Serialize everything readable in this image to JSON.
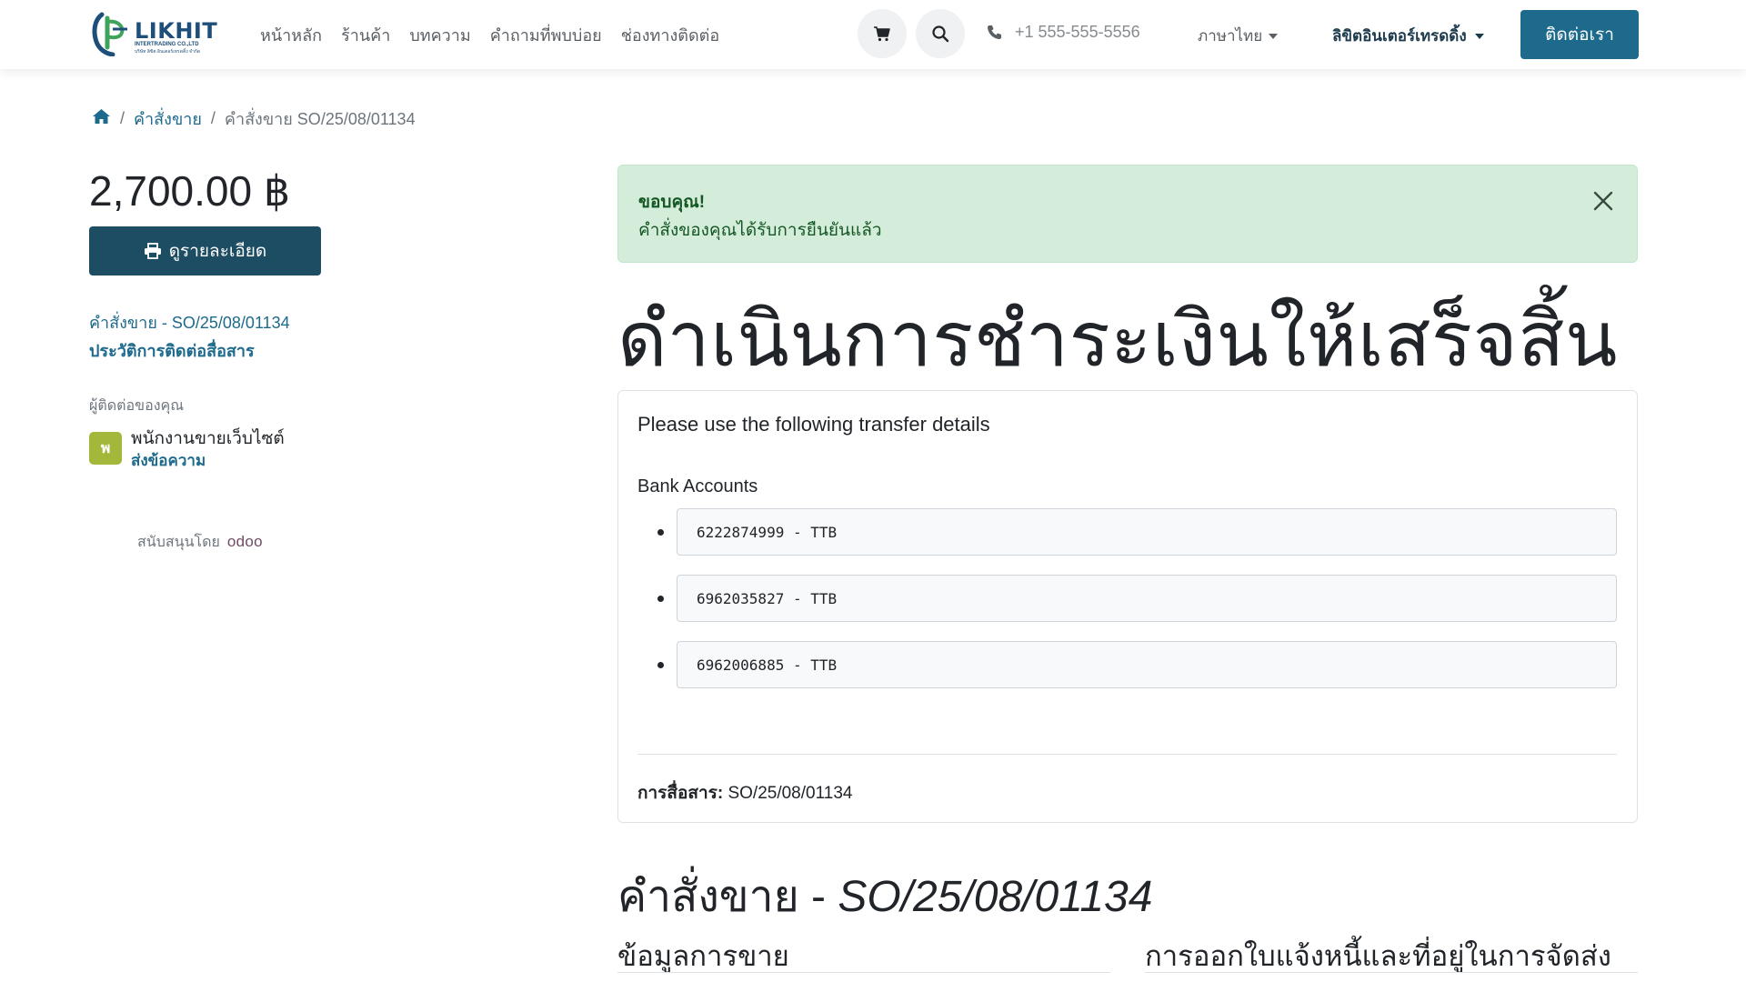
{
  "brand": {
    "name": "LIKHIT",
    "sub": "INTERTRADING CO.,LTD",
    "sub_th": "บริษัท ลิขิต อินเตอร์เทรดดิ้ง จำกัด",
    "colors": {
      "primary": "#1d6a8c",
      "dark": "#1d4d63",
      "logo_green": "#3fa35b"
    }
  },
  "nav": {
    "items": [
      "หน้าหลัก",
      "ร้านค้า",
      "บทความ",
      "คำถามที่พบบ่อย",
      "ช่องทางติดต่อ"
    ],
    "cart_icon": "cart-icon",
    "search_icon": "search-icon",
    "phone": "+1 555-555-5556",
    "language": "ภาษาไทย",
    "company": "ลิขิตอินเตอร์เทรดดิ้ง",
    "contact_button": "ติดต่อเรา"
  },
  "breadcrumb": {
    "home_icon": "home-icon",
    "orders": "คำสั่งขาย",
    "current": "คำสั่งขาย SO/25/08/01134"
  },
  "sidebar": {
    "amount": "2,700.00 ฿",
    "print_label": "ดูรายละเอียด",
    "order_link": "คำสั่งขาย - SO/25/08/01134",
    "history_link": "ประวัติการติดต่อสื่อสาร",
    "contact_label": "ผู้ติดต่อของคุณ",
    "avatar_letter": "พ",
    "contact_name": "พนักงานขายเว็บไซต์",
    "send_message": "ส่งข้อความ",
    "powered_by": "สนับสนุนโดย",
    "powered_brand": "odoo"
  },
  "alert": {
    "title": "ขอบคุณ!",
    "message": "คำสั่งของคุณได้รับการยืนยันแล้ว"
  },
  "page_heading": "ดำเนินการชำระเงินให้เสร็จสิ้น",
  "transfer": {
    "intro": "Please use the following transfer details",
    "accounts_label": "Bank Accounts",
    "accounts": [
      "6222874999 - TTB",
      "6962035827 - TTB",
      "6962006885 - TTB"
    ],
    "communication_label": "การสื่อสาร:",
    "communication_value": "SO/25/08/01134"
  },
  "order": {
    "title_prefix": "คำสั่งขาย - ",
    "title_number": "SO/25/08/01134",
    "section_sales": "ข้อมูลการขาย",
    "section_billing": "การออกใบแจ้งหนี้และที่อยู่ในการจัดส่ง"
  }
}
